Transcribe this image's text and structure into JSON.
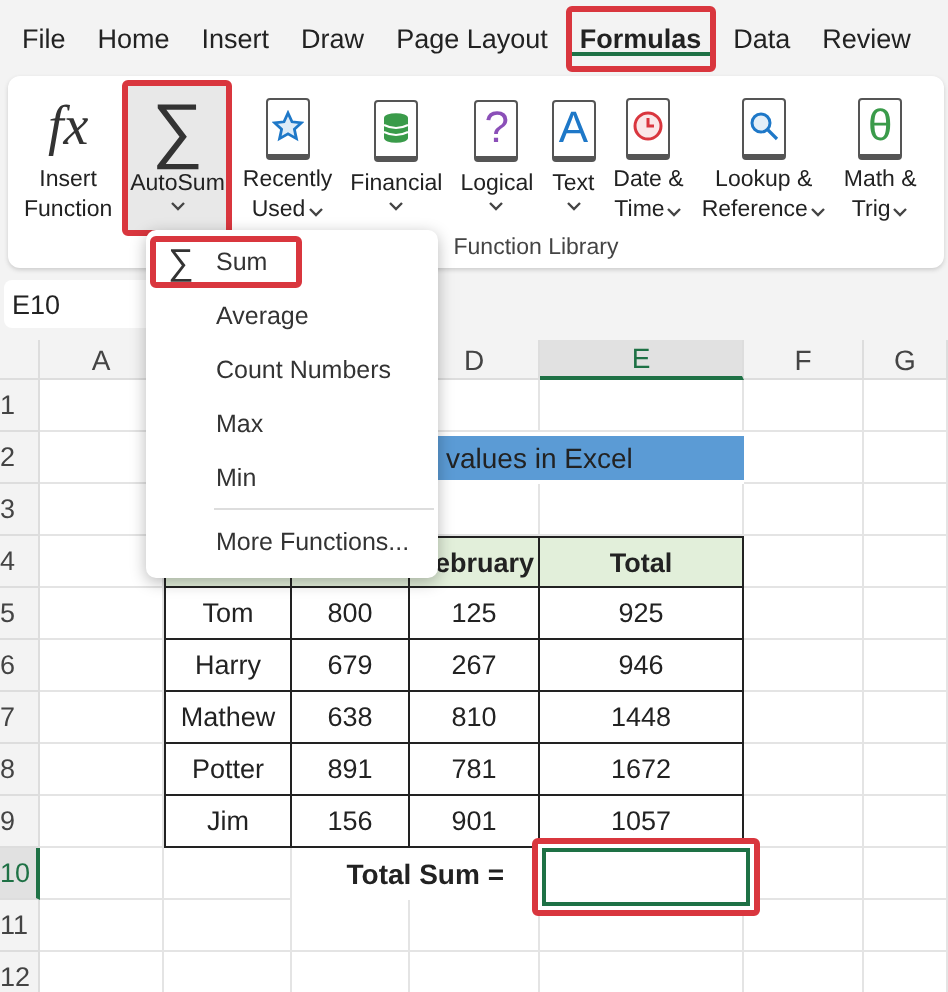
{
  "tabs": [
    {
      "label": "File",
      "selected": false,
      "highlighted": false
    },
    {
      "label": "Home",
      "selected": false,
      "highlighted": false
    },
    {
      "label": "Insert",
      "selected": false,
      "highlighted": false
    },
    {
      "label": "Draw",
      "selected": false,
      "highlighted": false
    },
    {
      "label": "Page Layout",
      "selected": false,
      "highlighted": false
    },
    {
      "label": "Formulas",
      "selected": true,
      "highlighted": true
    },
    {
      "label": "Data",
      "selected": false,
      "highlighted": false
    },
    {
      "label": "Review",
      "selected": false,
      "highlighted": false
    }
  ],
  "ribbon": {
    "group_label": "Function Library",
    "buttons": [
      {
        "lines": [
          "Insert",
          "Function"
        ],
        "kind": "fx",
        "glyph": "fx",
        "dropdown": false,
        "highlighted": false,
        "expanded": false
      },
      {
        "lines": [
          "AutoSum"
        ],
        "kind": "sigma",
        "glyph": "∑",
        "dropdown": true,
        "highlighted": true,
        "expanded": true
      },
      {
        "lines": [
          "Recently",
          "Used"
        ],
        "kind": "star",
        "color": "#1e78c8",
        "dropdown": true,
        "highlighted": false,
        "expanded": false
      },
      {
        "lines": [
          "Financial"
        ],
        "kind": "database",
        "color": "#3a9b4a",
        "dropdown": true,
        "highlighted": false,
        "expanded": false
      },
      {
        "lines": [
          "Logical"
        ],
        "kind": "glyph",
        "glyph": "?",
        "color": "#8b4fb8",
        "dropdown": true,
        "highlighted": false,
        "expanded": false
      },
      {
        "lines": [
          "Text"
        ],
        "kind": "glyph",
        "glyph": "A",
        "color": "#1e78c8",
        "dropdown": true,
        "highlighted": false,
        "expanded": false
      },
      {
        "lines": [
          "Date &",
          "Time"
        ],
        "kind": "clock",
        "color": "#d9363e",
        "dropdown": true,
        "highlighted": false,
        "expanded": false
      },
      {
        "lines": [
          "Lookup &",
          "Reference"
        ],
        "kind": "search",
        "color": "#1e78c8",
        "dropdown": true,
        "highlighted": false,
        "expanded": false
      },
      {
        "lines": [
          "Math &",
          "Trig"
        ],
        "kind": "glyph",
        "glyph": "θ",
        "color": "#3a9b4a",
        "dropdown": true,
        "highlighted": false,
        "expanded": false
      }
    ]
  },
  "name_box": "E10",
  "sheet": {
    "columns_left": [
      {
        "label": "A",
        "selected": false
      }
    ],
    "columns_right": [
      {
        "label": "D",
        "selected": false
      },
      {
        "label": "E",
        "selected": true
      },
      {
        "label": "F",
        "selected": false
      },
      {
        "label": "G",
        "selected": false
      }
    ],
    "rows": [
      {
        "label": "1",
        "selected": false
      },
      {
        "label": "2",
        "selected": false
      },
      {
        "label": "3",
        "selected": false
      },
      {
        "label": "4",
        "selected": false
      },
      {
        "label": "5",
        "selected": false
      },
      {
        "label": "6",
        "selected": false
      },
      {
        "label": "7",
        "selected": false
      },
      {
        "label": "8",
        "selected": false
      },
      {
        "label": "9",
        "selected": false
      },
      {
        "label": "10",
        "selected": true
      },
      {
        "label": "11",
        "selected": false
      },
      {
        "label": "12",
        "selected": false
      }
    ],
    "title": "values in Excel",
    "table": {
      "header_cells": [
        "ebruary",
        "Total"
      ],
      "rows": [
        [
          "Tom",
          "800",
          "125",
          "925"
        ],
        [
          "Harry",
          "679",
          "267",
          "946"
        ],
        [
          "Mathew",
          "638",
          "810",
          "1448"
        ],
        [
          "Potter",
          "891",
          "781",
          "1672"
        ],
        [
          "Jim",
          "156",
          "901",
          "1057"
        ]
      ],
      "total_label": "Total Sum =",
      "total_cell": {
        "selected": true,
        "highlighted": true
      }
    }
  },
  "menu": {
    "items": [
      {
        "kind": "item",
        "glyph": "∑",
        "label": "Sum",
        "highlighted": true
      },
      {
        "kind": "item",
        "label": "Average",
        "highlighted": false
      },
      {
        "kind": "item",
        "label": "Count Numbers",
        "highlighted": false
      },
      {
        "kind": "item",
        "label": "Max",
        "highlighted": false
      },
      {
        "kind": "item",
        "label": "Min",
        "highlighted": false
      },
      {
        "kind": "divider"
      },
      {
        "kind": "item",
        "label": "More Functions...",
        "highlighted": false
      }
    ]
  }
}
